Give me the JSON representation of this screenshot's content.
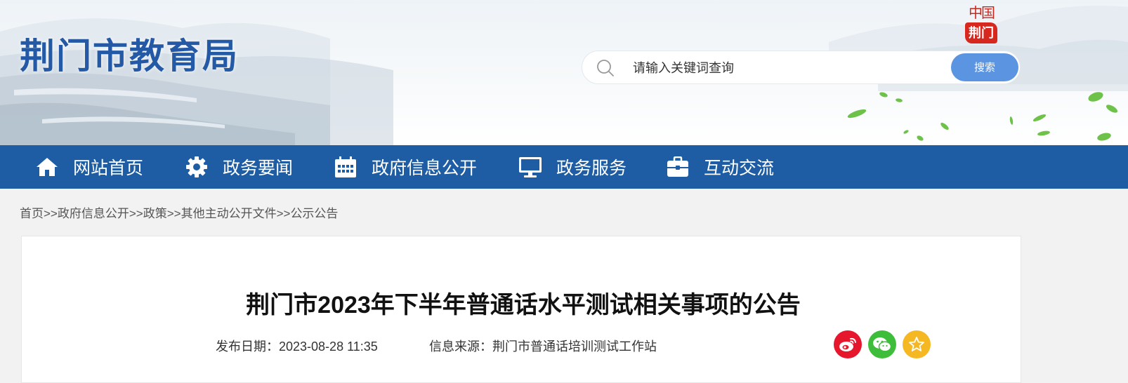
{
  "header": {
    "site_title": "荆门市教育局",
    "logo": {
      "top_text": "中国",
      "bottom_text": "荆门"
    },
    "search": {
      "placeholder": "请输入关键词查询",
      "button_label": "搜索"
    }
  },
  "nav": {
    "items": [
      {
        "label": "网站首页",
        "icon": "home-icon"
      },
      {
        "label": "政务要闻",
        "icon": "gear-icon"
      },
      {
        "label": "政府信息公开",
        "icon": "calendar-icon"
      },
      {
        "label": "政务服务",
        "icon": "monitor-icon"
      },
      {
        "label": "互动交流",
        "icon": "briefcase-icon"
      }
    ]
  },
  "breadcrumb": {
    "items": [
      "首页",
      "政府信息公开",
      "政策",
      "其他主动公开文件",
      "公示公告"
    ],
    "separator": ">>"
  },
  "article": {
    "title": "荆门市2023年下半年普通话水平测试相关事项的公告",
    "publish_date_label": "发布日期：",
    "publish_date": "2023-08-28 11:35",
    "source_label": "信息来源：",
    "source": "荆门市普通话培训测试工作站"
  },
  "share": {
    "items": [
      {
        "name": "weibo-share-icon",
        "color": "#e6162d"
      },
      {
        "name": "wechat-share-icon",
        "color": "#3ebd3a"
      },
      {
        "name": "favorite-icon",
        "color": "#f5b822"
      }
    ]
  },
  "colors": {
    "nav_bg": "#1e5da3",
    "title_blue": "#2459a6",
    "search_button": "#5b94e0"
  }
}
